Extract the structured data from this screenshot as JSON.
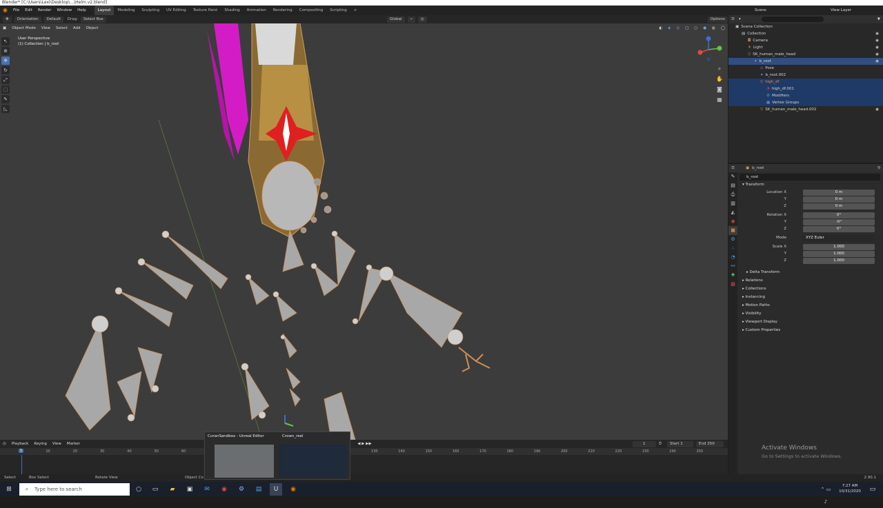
{
  "window": {
    "title": "Blender* [C:\\Users\\Lexi\\Desktop\\...\\Helm.v2.blend]"
  },
  "menu": [
    "File",
    "Edit",
    "Render",
    "Window",
    "Help"
  ],
  "workspaces": [
    "Layout",
    "Modeling",
    "Sculpting",
    "UV Editing",
    "Texture Paint",
    "Shading",
    "Animation",
    "Rendering",
    "Compositing",
    "Scripting"
  ],
  "active_workspace": "Layout",
  "top_right": {
    "scene": "Scene",
    "view_layer": "View Layer"
  },
  "tool_header": {
    "orientation": "Orientation",
    "transform": "Default",
    "drag_label": "Drag:",
    "drag": "Select Box",
    "global": "Global",
    "options": "Options"
  },
  "viewport_header": {
    "mode": "Object Mode",
    "view": "View",
    "select": "Select",
    "add": "Add",
    "object": "Object"
  },
  "viewport_info": {
    "line1": "User Perspective",
    "line2": "(1) Collection | b_root"
  },
  "outliner": {
    "search_placeholder": "",
    "rows": [
      {
        "label": "Scene Collection",
        "indent": 0
      },
      {
        "label": "Collection",
        "indent": 1
      },
      {
        "label": "Camera",
        "indent": 2
      },
      {
        "label": "Light",
        "indent": 2
      },
      {
        "label": "SK_human_male_head",
        "indent": 2
      },
      {
        "label": "b_root",
        "indent": 3
      },
      {
        "label": "Pose",
        "indent": 4
      },
      {
        "label": "b_root.002",
        "indent": 4
      },
      {
        "label": "high_df",
        "indent": 4
      },
      {
        "label": "high_df.001",
        "indent": 5
      },
      {
        "label": "Modifiers",
        "indent": 5
      },
      {
        "label": "Vertex Groups",
        "indent": 5
      },
      {
        "label": "SK_human_male_head.002",
        "indent": 4
      }
    ]
  },
  "properties": {
    "object_name": "b_root",
    "object_field": "b_root",
    "transform_title": "Transform",
    "location_label": "Location X",
    "location": [
      "0 m",
      "0 m",
      "0 m"
    ],
    "rotation_label": "Rotation X",
    "rotation": [
      "0°",
      "-0°",
      "0°"
    ],
    "mode_label": "Mode",
    "mode": "XYZ Euler",
    "scale_label": "Scale X",
    "scale": [
      "1.000",
      "1.000",
      "1.000"
    ],
    "axis_y": "Y",
    "axis_z": "Z",
    "sections": [
      "Delta Transform",
      "Relations",
      "Collections",
      "Instancing",
      "Motion Paths",
      "Visibility",
      "Viewport Display",
      "Custom Properties"
    ]
  },
  "timeline": {
    "playback": "Playback",
    "keying": "Keying",
    "view": "View",
    "marker": "Marker",
    "current_frame": "1",
    "start_label": "Start",
    "start": "1",
    "end_label": "End",
    "end": "250",
    "ticks": [
      "10",
      "20",
      "30",
      "40",
      "50",
      "60",
      "130",
      "140",
      "150",
      "160",
      "170",
      "180",
      "190",
      "200",
      "210",
      "220",
      "230",
      "240",
      "250"
    ]
  },
  "thumbnail_popup": {
    "item1": "CuranSandbox - Unreal Editor",
    "item2": "Crown_reel"
  },
  "statusbar": {
    "select": "Select",
    "box_select": "Box Select",
    "rotate_view": "Rotate View",
    "object_context": "Object Co",
    "version": "2.90.1"
  },
  "taskbar": {
    "search_placeholder": "Type here to search",
    "time": "7:27 AM",
    "date": "10/31/2020"
  },
  "activate_windows": {
    "title": "Activate Windows",
    "subtitle": "Go to Settings to activate Windows."
  },
  "colors": {
    "accent": "#4772b3",
    "selected_row": "#334d80",
    "viewport_bg": "#3c3c3c",
    "magenta_feathers": "#e020d0",
    "helmet_gold": "#b08840"
  }
}
